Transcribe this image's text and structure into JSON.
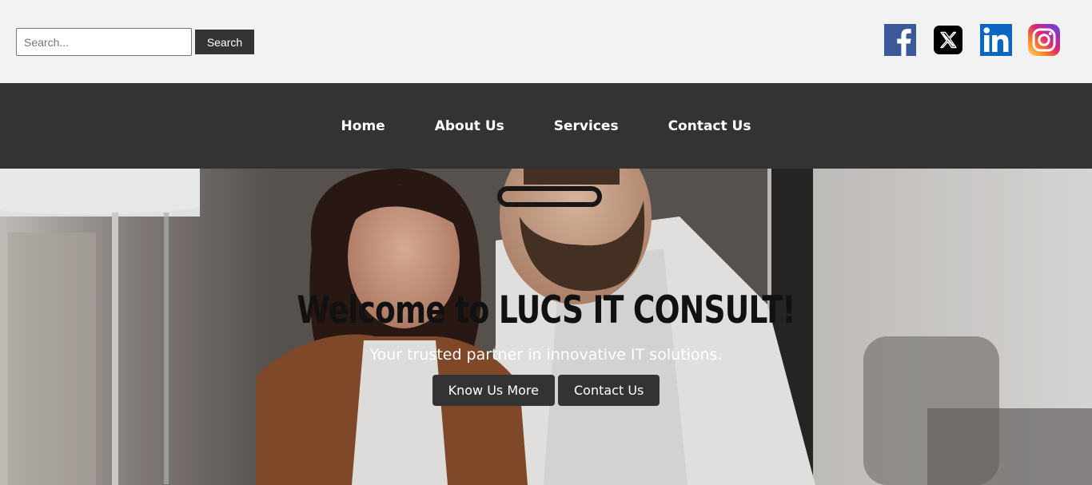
{
  "search": {
    "placeholder": "Search...",
    "button_label": "Search"
  },
  "socials": [
    {
      "name": "facebook-icon",
      "color": "#3b5998"
    },
    {
      "name": "x-icon",
      "color": "#000000"
    },
    {
      "name": "linkedin-icon",
      "color": "#0a66c2"
    },
    {
      "name": "instagram-icon",
      "color": "#e1306c"
    }
  ],
  "nav": {
    "items": [
      {
        "label": "Home"
      },
      {
        "label": "About Us"
      },
      {
        "label": "Services"
      },
      {
        "label": "Contact Us"
      }
    ]
  },
  "hero": {
    "title": "Welcome to LUCS IT CONSULT!",
    "subtitle": "Your trusted partner in innovative IT solutions.",
    "buttons": [
      {
        "label": "Know Us More"
      },
      {
        "label": "Contact Us"
      }
    ]
  },
  "colors": {
    "nav_bg": "#333333",
    "top_bg": "#f2f2f2",
    "button_bg": "#333333"
  }
}
